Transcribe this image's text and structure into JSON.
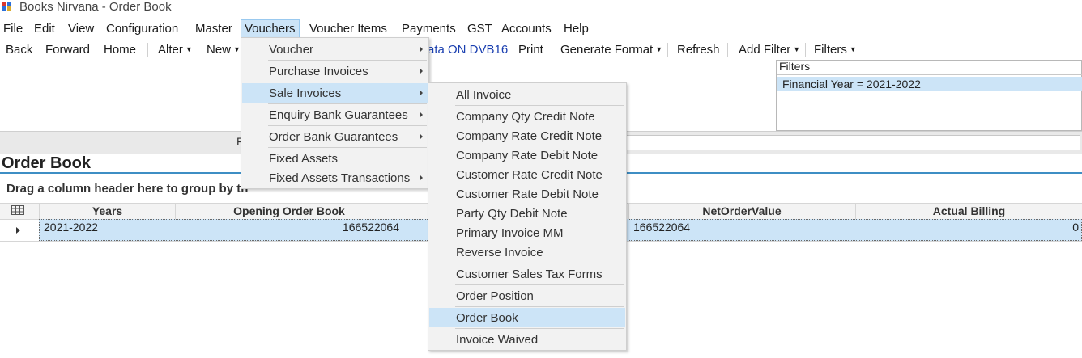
{
  "window": {
    "title": "Books Nirvana - Order Book"
  },
  "menubar": {
    "items": [
      "File",
      "Edit",
      "View",
      "Configuration",
      "Master",
      "Vouchers",
      "Voucher Items",
      "Payments",
      "GST",
      "Accounts",
      "Help"
    ],
    "active": "Vouchers"
  },
  "toolbar": {
    "back": "Back",
    "forward": "Forward",
    "home": "Home",
    "alter": "Alter",
    "new": "New",
    "link_partial": "ata ON DVB16",
    "print": "Print",
    "generate_format": "Generate Format",
    "refresh": "Refresh",
    "add_filter": "Add Filter",
    "filters": "Filters"
  },
  "filters_panel": {
    "title": "Filters",
    "items": [
      "Financial Year = 2021-2022"
    ]
  },
  "band_text": "F",
  "page": {
    "heading": "Order Book",
    "group_hint": "Drag a column header here to group by th"
  },
  "grid": {
    "columns": [
      "Years",
      "Opening Order Book",
      "NetOrderValue",
      "Actual Billing"
    ],
    "rows": [
      {
        "years": "2021-2022",
        "opening_order_book": "166522064",
        "net_order_value": "166522064",
        "actual_billing": "0"
      }
    ]
  },
  "vouchers_menu": {
    "items": [
      {
        "label": "Voucher",
        "submenu": true
      },
      {
        "label": "Purchase Invoices",
        "submenu": true
      },
      {
        "label": "Sale Invoices",
        "submenu": true,
        "highlighted": true
      },
      {
        "label": "Enquiry Bank Guarantees",
        "submenu": true
      },
      {
        "label": "Order Bank Guarantees",
        "submenu": true
      },
      {
        "label": "Fixed Assets",
        "submenu": false
      },
      {
        "label": "Fixed Assets Transactions",
        "submenu": true
      }
    ]
  },
  "sale_invoices_menu": {
    "items": [
      "All Invoice",
      "Company Qty Credit Note",
      "Company Rate Credit Note",
      "Company Rate Debit Note",
      "Customer Rate Credit Note",
      "Customer Rate Debit Note",
      "Party Qty Debit Note",
      "Primary Invoice MM",
      "Reverse Invoice",
      "Customer Sales Tax Forms",
      "Order Position",
      "Order Book",
      "Invoice Waived"
    ],
    "highlighted": "Order Book"
  },
  "colors": {
    "highlight": "#cce4f7",
    "accent_line": "#3e8ec4",
    "link": "#1a3fb0"
  }
}
